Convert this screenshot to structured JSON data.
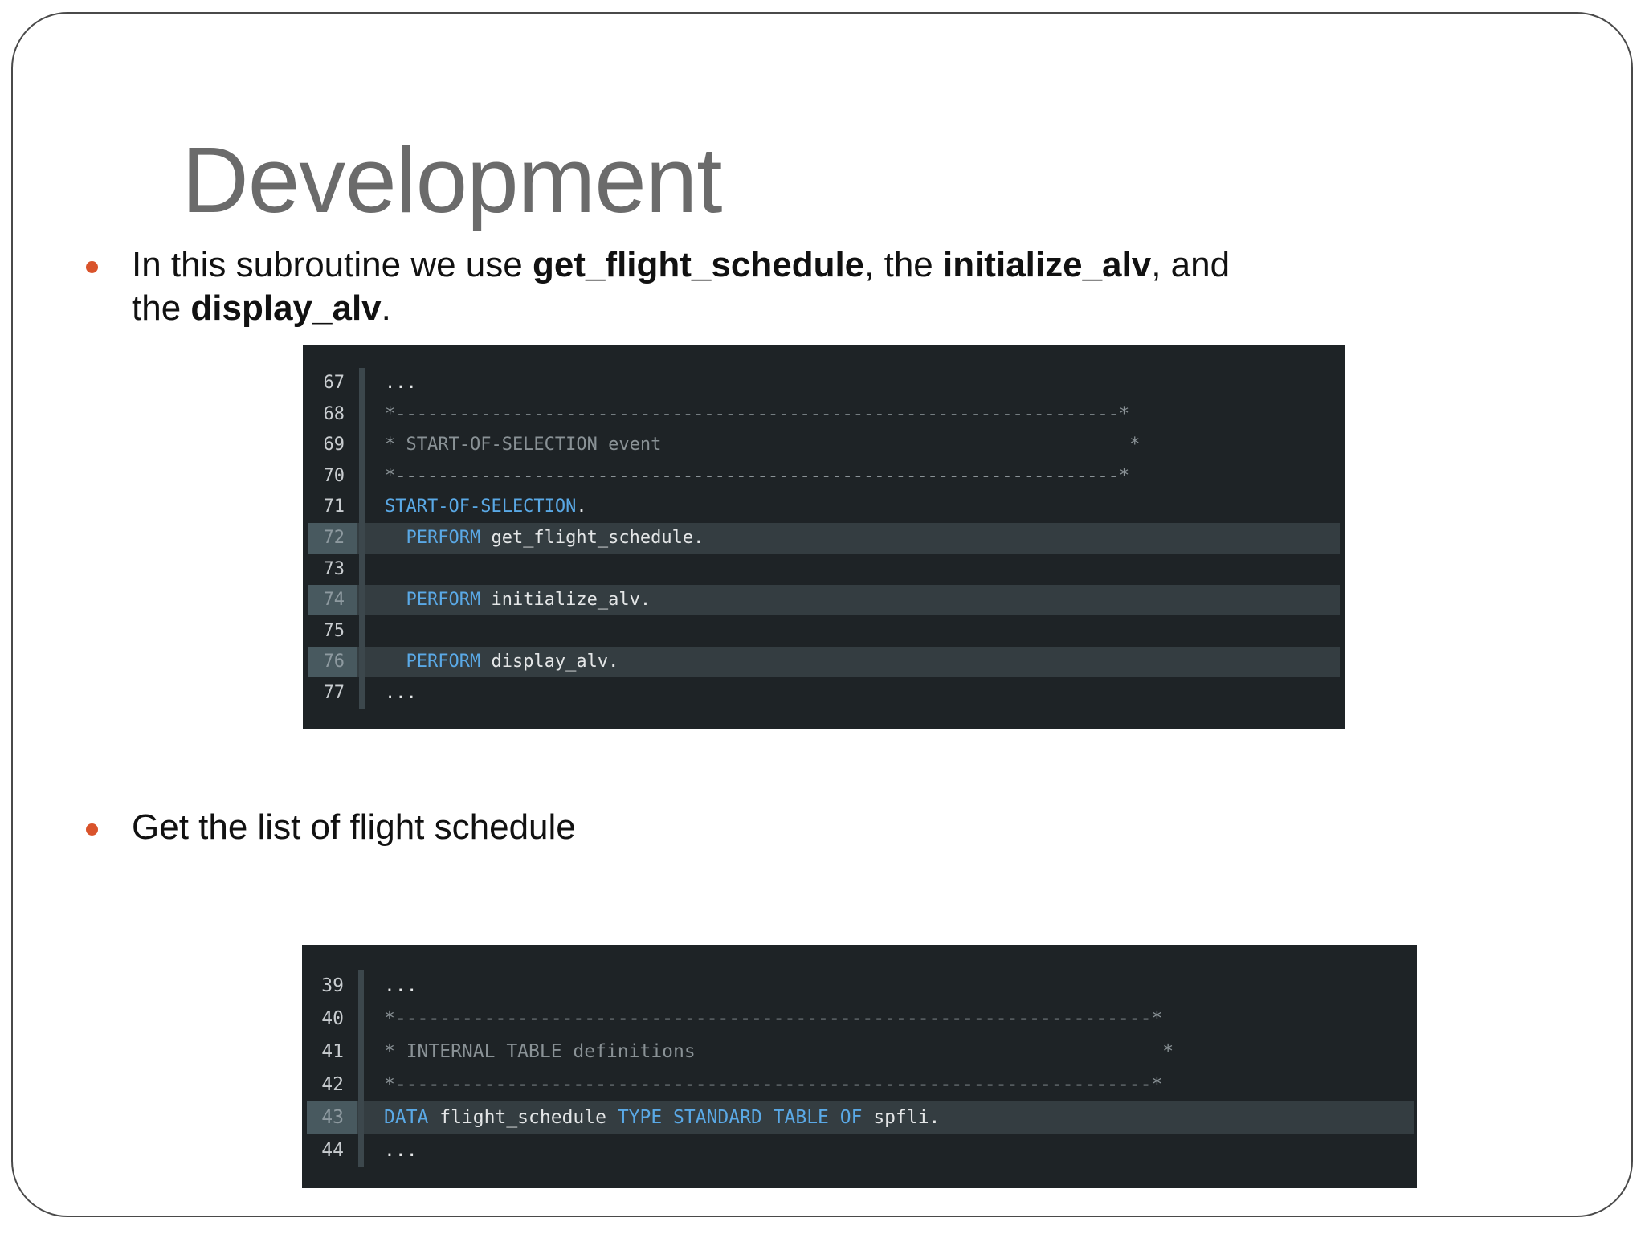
{
  "slide": {
    "title": "Development",
    "bullets": [
      {
        "line1": [
          {
            "text": "In this subroutine we use ",
            "bold": false
          },
          {
            "text": "get_flight_schedule",
            "bold": true
          },
          {
            "text": ", the ",
            "bold": false
          },
          {
            "text": "initialize_alv",
            "bold": true
          },
          {
            "text": ", and",
            "bold": false
          }
        ],
        "line2": [
          {
            "text": "the ",
            "bold": false
          },
          {
            "text": "display_alv",
            "bold": true
          },
          {
            "text": ".",
            "bold": false
          }
        ]
      },
      {
        "line1": [
          {
            "text": "Get the list of flight schedule",
            "bold": false
          }
        ]
      }
    ]
  },
  "code_block_1": {
    "lines": [
      {
        "num": "67",
        "highlighted": false,
        "tokens": [
          {
            "t": "...",
            "k": "id"
          }
        ]
      },
      {
        "num": "68",
        "highlighted": false,
        "tokens": [
          {
            "t": "*--------------------------------------------------------------------*",
            "k": "cm"
          }
        ]
      },
      {
        "num": "69",
        "highlighted": false,
        "tokens": [
          {
            "t": "* START-OF-SELECTION event                                            *",
            "k": "cm"
          }
        ]
      },
      {
        "num": "70",
        "highlighted": false,
        "tokens": [
          {
            "t": "*--------------------------------------------------------------------*",
            "k": "cm"
          }
        ]
      },
      {
        "num": "71",
        "highlighted": false,
        "tokens": [
          {
            "t": "START-OF-SELECTION",
            "k": "kw"
          },
          {
            "t": ".",
            "k": "id"
          }
        ]
      },
      {
        "num": "72",
        "highlighted": true,
        "tokens": [
          {
            "t": "  PERFORM ",
            "k": "kw"
          },
          {
            "t": "get_flight_schedule.",
            "k": "id"
          }
        ]
      },
      {
        "num": "73",
        "highlighted": false,
        "tokens": []
      },
      {
        "num": "74",
        "highlighted": true,
        "tokens": [
          {
            "t": "  PERFORM ",
            "k": "kw"
          },
          {
            "t": "initialize_alv.",
            "k": "id"
          }
        ]
      },
      {
        "num": "75",
        "highlighted": false,
        "tokens": []
      },
      {
        "num": "76",
        "highlighted": true,
        "tokens": [
          {
            "t": "  PERFORM ",
            "k": "kw"
          },
          {
            "t": "display_alv.",
            "k": "id"
          }
        ]
      },
      {
        "num": "77",
        "highlighted": false,
        "tokens": [
          {
            "t": "...",
            "k": "id"
          }
        ]
      }
    ]
  },
  "code_block_2": {
    "lines": [
      {
        "num": "39",
        "highlighted": false,
        "tokens": [
          {
            "t": "...",
            "k": "id"
          }
        ]
      },
      {
        "num": "40",
        "highlighted": false,
        "tokens": [
          {
            "t": "*--------------------------------------------------------------------*",
            "k": "cm"
          }
        ]
      },
      {
        "num": "41",
        "highlighted": false,
        "tokens": [
          {
            "t": "* INTERNAL TABLE definitions                                          *",
            "k": "cm"
          }
        ]
      },
      {
        "num": "42",
        "highlighted": false,
        "tokens": [
          {
            "t": "*--------------------------------------------------------------------*",
            "k": "cm"
          }
        ]
      },
      {
        "num": "43",
        "highlighted": true,
        "tokens": [
          {
            "t": "DATA ",
            "k": "kw"
          },
          {
            "t": "flight_schedule ",
            "k": "id"
          },
          {
            "t": "TYPE STANDARD TABLE OF ",
            "k": "kw"
          },
          {
            "t": "spfli.",
            "k": "id"
          }
        ]
      },
      {
        "num": "44",
        "highlighted": false,
        "tokens": [
          {
            "t": "...",
            "k": "id"
          }
        ]
      }
    ]
  }
}
